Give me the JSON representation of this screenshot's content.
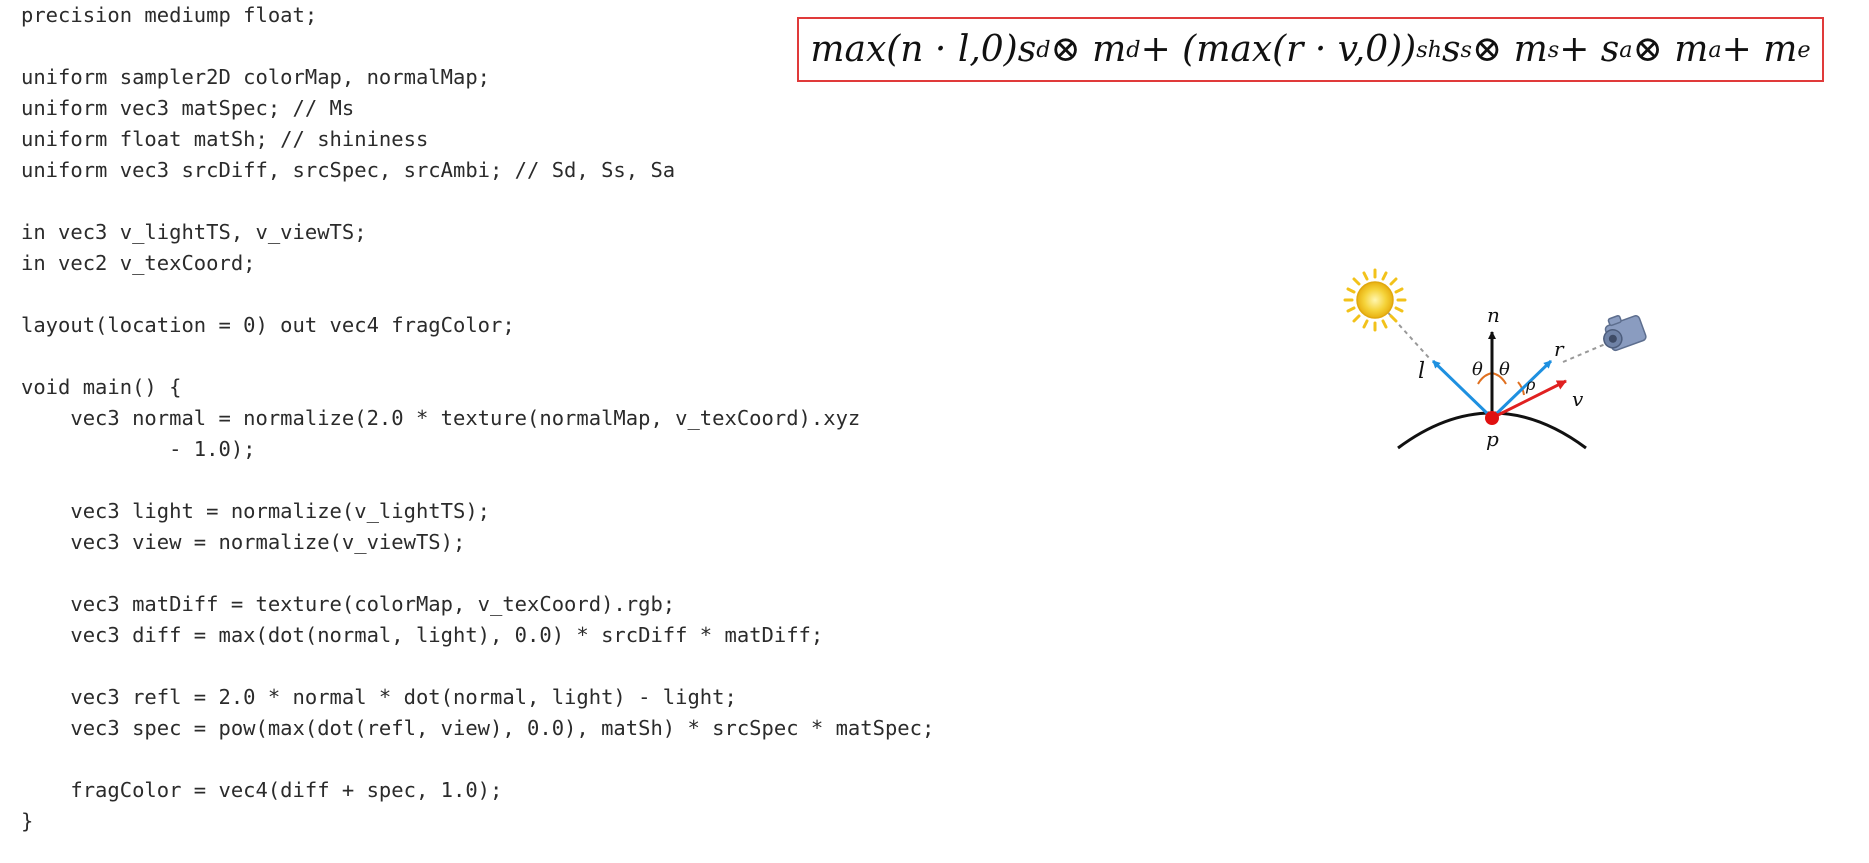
{
  "code_lines": [
    "precision mediump float;",
    "",
    "uniform sampler2D colorMap, normalMap;",
    "uniform vec3 matSpec; // Ms",
    "uniform float matSh; // shininess",
    "uniform vec3 srcDiff, srcSpec, srcAmbi; // Sd, Ss, Sa",
    "",
    "in vec3 v_lightTS, v_viewTS;",
    "in vec2 v_texCoord;",
    "",
    "layout(location = 0) out vec4 fragColor;",
    "",
    "void main() {",
    "    vec3 normal = normalize(2.0 * texture(normalMap, v_texCoord).xyz",
    "            - 1.0);",
    "",
    "    vec3 light = normalize(v_lightTS);",
    "    vec3 view = normalize(v_viewTS);",
    "",
    "    vec3 matDiff = texture(colorMap, v_texCoord).rgb;",
    "    vec3 diff = max(dot(normal, light), 0.0) * srcDiff * matDiff;",
    "",
    "    vec3 refl = 2.0 * normal * dot(normal, light) - light;",
    "    vec3 spec = pow(max(dot(refl, view), 0.0), matSh) * srcSpec * matSpec;",
    "",
    "    fragColor = vec4(diff + spec, 1.0);",
    "}"
  ],
  "formula": {
    "t1": "max(n · l,0)",
    "s_d": "d",
    "t2": " ⊗ m",
    "m_d": "d",
    "t3": " + (max(r · v,0))",
    "sh": "sh",
    "t4": "s",
    "s_s": "s",
    "t5": " ⊗ m",
    "m_s": "s",
    "t6": " + s",
    "s_a": "a",
    "t7": " ⊗ m",
    "m_a": "a",
    "t8": " + m",
    "m_e": "e",
    "s_prefix": "s"
  },
  "diagram": {
    "labels": {
      "n": "n",
      "l": "l",
      "r": "r",
      "v": "v",
      "p": "p",
      "theta_left": "θ",
      "theta_right": "θ",
      "rho": "ρ"
    },
    "colors": {
      "normal": "#111111",
      "light_vector": "#1e90e0",
      "reflect_vector": "#1e90e0",
      "view_vector": "#e02020",
      "point": "#e01010",
      "angle_arc": "#e07020",
      "sun": "#f2c21a",
      "camera": "#7b8fb0",
      "surface": "#111111"
    },
    "icons": {
      "light_source": "sun-icon",
      "viewer": "camera-icon"
    }
  },
  "border_color": "#e03a3a"
}
